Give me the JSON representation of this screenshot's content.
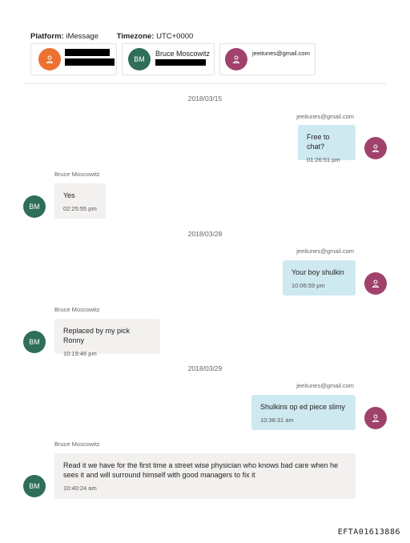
{
  "header": {
    "platform_label": "Platform:",
    "platform_value": "iMessage",
    "timezone_label": "Timezone:",
    "timezone_value": "UTC+0000"
  },
  "participants": [
    {
      "initials": "",
      "name": "",
      "color": "#ec7130",
      "icon": "person-icon"
    },
    {
      "initials": "BM",
      "name": "Bruce Moscowitz",
      "color": "#2f6e59"
    },
    {
      "initials": "",
      "name": "jeeitunes@gmail.com",
      "color": "#a0426b",
      "icon": "person-icon"
    }
  ],
  "messages": [
    {
      "date": "2018/03/15",
      "sender": "jeeitunes@gmail.com",
      "direction": "outgoing",
      "text": "Free to chat?",
      "time": "01:26:51 pm"
    },
    {
      "sender": "Bruce Moscowitz",
      "direction": "incoming",
      "initials": "BM",
      "text": "Yes",
      "time": "02:25:55 pm"
    },
    {
      "date": "2018/03/28",
      "sender": "jeeitunes@gmail.com",
      "direction": "outgoing",
      "text": "Your boy shulkin",
      "time": "10:06:59 pm"
    },
    {
      "sender": "Bruce Moscowitz",
      "direction": "incoming",
      "initials": "BM",
      "text": "Replaced by my pick Ronny",
      "time": "10:19:46 pm"
    },
    {
      "date": "2018/03/29",
      "sender": "jeeitunes@gmail.com",
      "direction": "outgoing",
      "text": "Shulkins op ed piece slimy",
      "time": "10:38:31 am"
    },
    {
      "sender": "Bruce Moscowitz",
      "direction": "incoming",
      "initials": "BM",
      "text": "Read it we have for the first time a street wise physician who knows bad care when he sees it and will surround himself with good managers to fix it",
      "time": "10:40:24 am"
    }
  ],
  "footer": {
    "doc_id": "EFTA01613886"
  }
}
